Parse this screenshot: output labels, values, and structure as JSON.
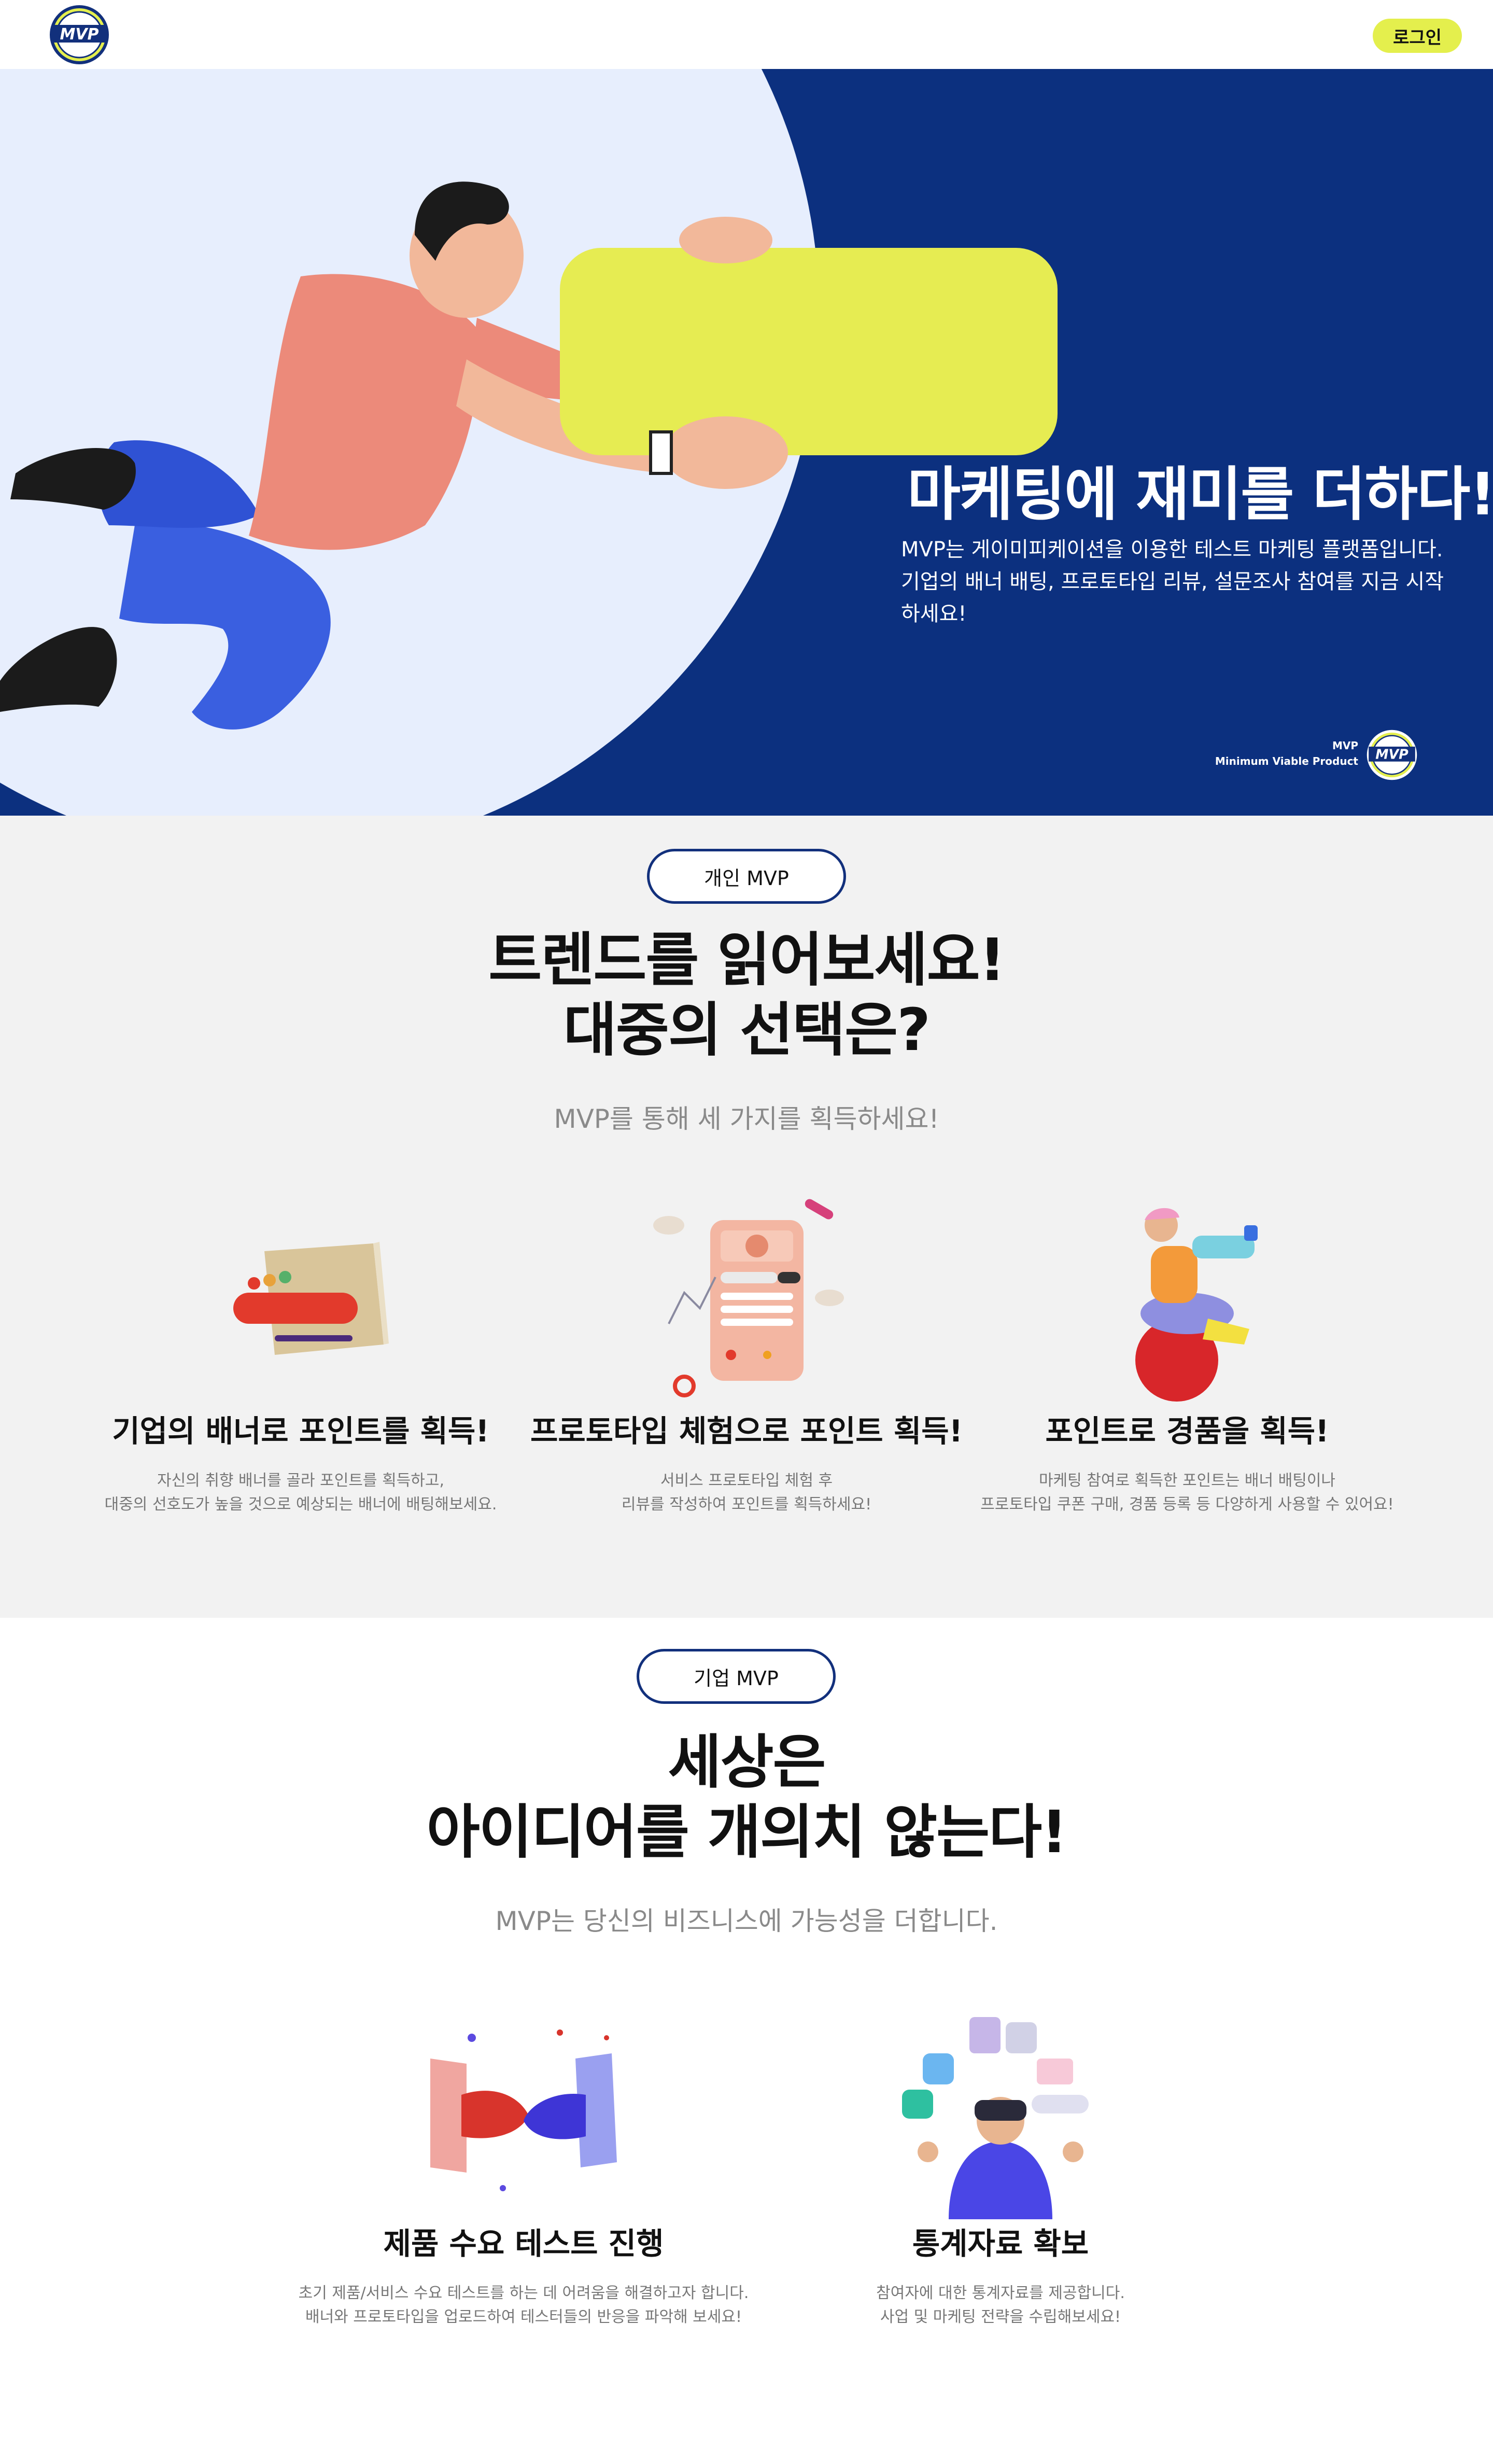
{
  "header": {
    "logo_text": "MVP",
    "login_label": "로그인"
  },
  "hero": {
    "title": "마케팅에 재미를 더하다!",
    "description": "MVP는 게이미피케이션을 이용한 테스트 마케팅 플랫폼입니다. 기업의 배너 배팅, 프로토타입 리뷰, 설문조사 참여를 지금 시작하세요!",
    "brand_line1": "MVP",
    "brand_line2": "Minimum Viable Product",
    "colors": {
      "background": "#0c307f",
      "circle": "#e7eefd",
      "accent": "#e4ef4d"
    }
  },
  "personal": {
    "badge": "개인 MVP",
    "title_line1": "트렌드를 읽어보세요!",
    "title_line2": "대중의 선택은?",
    "subtitle": "MVP를 통해 세 가지를 획득하세요!",
    "features": [
      {
        "icon": "banner-icon",
        "title": "기업의 배너로 포인트를 획득!",
        "desc_line1": "자신의 취향 배너를 골라 포인트를 획득하고,",
        "desc_line2": "대중의 선호도가 높을 것으로 예상되는 배너에 배팅해보세요."
      },
      {
        "icon": "prototype-phone-icon",
        "title": "프로토타입 체험으로 포인트 획득!",
        "desc_line1": "서비스 프로토타입 체험 후",
        "desc_line2": "리뷰를 작성하여 포인트를 획득하세요!"
      },
      {
        "icon": "reward-character-icon",
        "title": "포인트로 경품을 획득!",
        "desc_line1": "마케팅 참여로 획득한 포인트는 배너 배팅이나",
        "desc_line2": "프로토타입 쿠폰 구매, 경품 등록 등 다양하게 사용할 수 있어요!"
      }
    ]
  },
  "corporate": {
    "badge": "기업 MVP",
    "title_line1": "세상은",
    "title_line2": "아이디어를 개의치 않는다!",
    "subtitle": "MVP는 당신의 비즈니스에 가능성을 더합니다.",
    "features": [
      {
        "icon": "handshake-icon",
        "title": "제품 수요 테스트 진행",
        "desc_line1": "초기 제품/서비스 수요 테스트를 하는 데 어려움을 해결하고자 합니다.",
        "desc_line2": "배너와 프로토타입을 업로드하여 테스터들의 반응을 파악해 보세요!"
      },
      {
        "icon": "statistics-vr-icon",
        "title": "통계자료 확보",
        "desc_line1": "참여자에 대한 통계자료를 제공합니다.",
        "desc_line2": "사업 및 마케팅 전략을 수립해보세요!"
      }
    ]
  }
}
